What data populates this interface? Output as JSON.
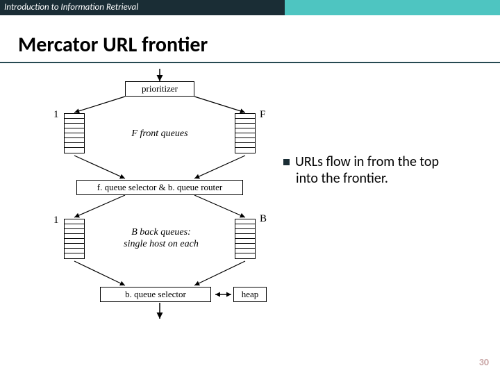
{
  "header": {
    "course": "Introduction to Information Retrieval"
  },
  "title": "Mercator URL frontier",
  "diagram": {
    "prioritizer": "prioritizer",
    "front_left_label": "1",
    "front_right_label": "F",
    "front_caption": "F front queues",
    "selector_router": "f. queue selector & b. queue router",
    "back_left_label": "1",
    "back_right_label": "B",
    "back_caption_line1": "B back queues:",
    "back_caption_line2": "single host on each",
    "back_selector": "b. queue selector",
    "heap": "heap"
  },
  "bullet": {
    "line1": "URLs flow in from the top",
    "line2": "into the frontier."
  },
  "pagenum": "30"
}
